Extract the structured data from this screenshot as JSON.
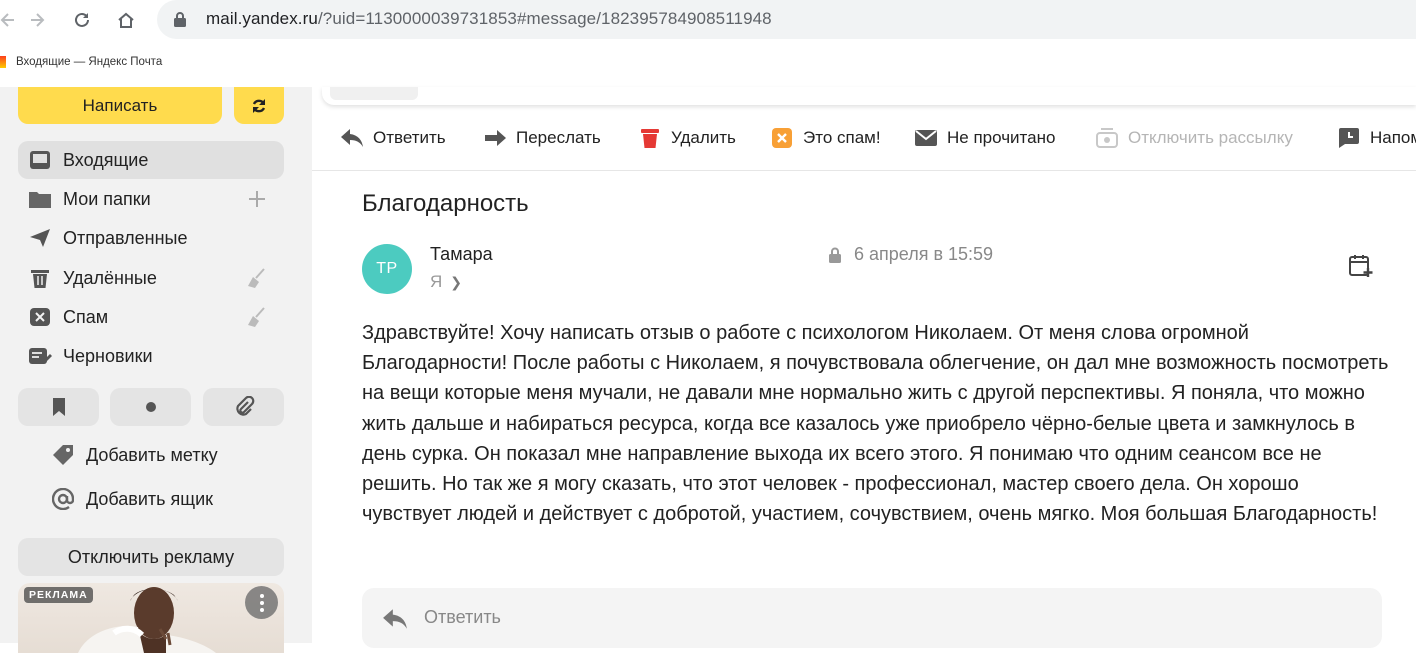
{
  "browser": {
    "url_host": "mail.yandex.ru",
    "url_rest": "/?uid=1130000039731853#message/182395784908511948",
    "bookmark_label": "Входящие — Яндекс Почта"
  },
  "sidebar": {
    "compose_label": "Написать",
    "folders": [
      {
        "label": "Входящие",
        "icon": "inbox-icon"
      },
      {
        "label": "Мои папки",
        "icon": "folder-icon"
      },
      {
        "label": "Отправленные",
        "icon": "send-icon"
      },
      {
        "label": "Удалённые",
        "icon": "trash-icon"
      },
      {
        "label": "Спам",
        "icon": "spam-icon"
      },
      {
        "label": "Черновики",
        "icon": "drafts-icon"
      }
    ],
    "add_label": "Добавить метку",
    "add_mailbox": "Добавить ящик",
    "disable_ads": "Отключить рекламу",
    "ad_tag": "РЕКЛАМА"
  },
  "toolbar": {
    "reply": "Ответить",
    "forward": "Переслать",
    "delete": "Удалить",
    "spam": "Это спам!",
    "unread": "Не прочитано",
    "unsubscribe": "Отключить рассылку",
    "remind": "Напом"
  },
  "message": {
    "subject": "Благодарность",
    "avatar_initials": "ТР",
    "avatar_color": "#4ccbc0",
    "sender_name": "Тамара",
    "date": "6 апреля в 15:59",
    "recipient": "Я",
    "body": "Здравствуйте! Хочу написать отзыв о работе с психологом Николаем. От меня слова огромной Благодарности! После работы с Николаем, я почувствовала облегчение, он дал мне возможность посмотреть на вещи которые меня мучали, не давали мне нормально жить с другой перспективы. Я поняла, что можно жить дальше и набираться ресурса, когда все казалось уже приобрело чёрно-белые цвета и замкнулось в день сурка. Он показал мне направление выхода их всего этого. Я понимаю что одним сеансом все не решить. Но так же я могу сказать, что этот человек - профессионал, мастер своего дела. Он хорошо чувствует людей и действует с добротой, участием, сочувствием, очень мягко. Моя большая Благодарность!",
    "reply_placeholder": "Ответить"
  },
  "colors": {
    "accent_yellow": "#ffdb4d",
    "sidebar_bg": "#f2f2f2",
    "spam_orange": "#f8a036",
    "delete_red": "#e53935"
  }
}
